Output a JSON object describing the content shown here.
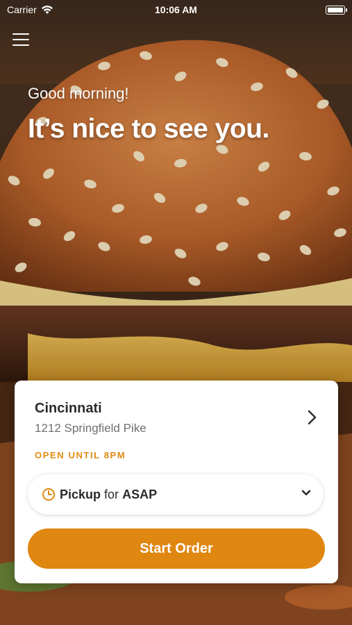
{
  "status_bar": {
    "carrier": "Carrier",
    "time": "10:06 AM",
    "icons": [
      "wifi-icon",
      "battery-icon"
    ]
  },
  "header": {
    "menu_icon": "hamburger-menu-icon",
    "greeting": "Good morning!",
    "headline": "It’s nice to see you."
  },
  "store_card": {
    "name": "Cincinnati",
    "address": "1212 Springfield Pike",
    "hours": "OPEN UNTIL 8PM",
    "order_mode": {
      "method": "Pickup",
      "connector": "for",
      "time": "ASAP"
    },
    "start_button": "Start Order"
  },
  "colors": {
    "accent": "#df8710",
    "hours_text": "#e08a12",
    "card_bg": "#ffffff",
    "text_primary": "#2b2b2b",
    "text_secondary": "#6f6f6f"
  }
}
